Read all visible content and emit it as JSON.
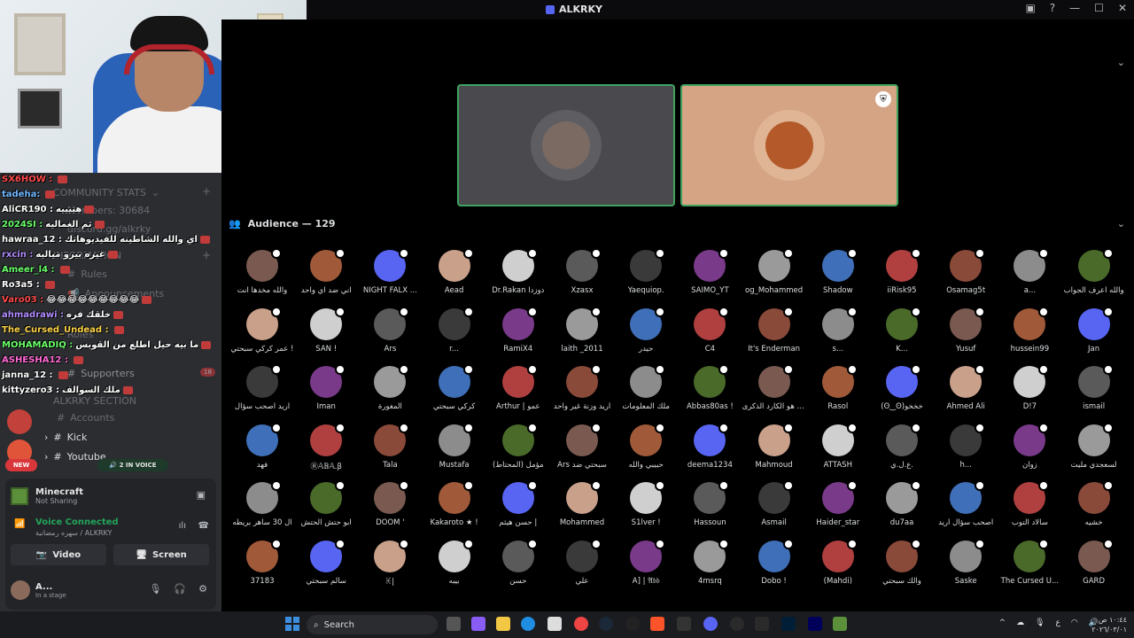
{
  "window": {
    "title": "ALKRKY"
  },
  "sidebar": {
    "stats_header": "COMMUNITY STATS",
    "members": "Members: 30684",
    "invite": "discord.gg/alkrky",
    "info_header": "INFORMATION",
    "rules": "Rules",
    "announcements": "Announcements",
    "roles": "Roles",
    "supporters": "Supporters",
    "supporters_badge": "18",
    "alkrky_section": "ALKRKY SECTION",
    "accounts": "Accounts",
    "kick": "Kick",
    "youtube": "Youtube",
    "new_badge": "NEW",
    "in_voice": "2 IN VOICE"
  },
  "chat": [
    {
      "user": "SX6HOW :",
      "color": "#ff4a4a",
      "msg": ""
    },
    {
      "user": "tadeha:",
      "color": "#6fb7ff",
      "msg": ""
    },
    {
      "user": "AliCR190 :",
      "color": "#ffffff",
      "msg": "هييييه"
    },
    {
      "user": "2024SI :",
      "color": "#6aff6a",
      "msg": "ثم الغماليه"
    },
    {
      "user": "hawraa_12 :",
      "color": "#ffffff",
      "msg": "اي والله الشاطينه للفيديوهاتك"
    },
    {
      "user": "rxcin :",
      "color": "#b28cff",
      "msg": "غيره بيرو مياليه"
    },
    {
      "user": "Ameer_l4 :",
      "color": "#6aff6a",
      "msg": ""
    },
    {
      "user": "Ro3a5 :",
      "color": "#ffffff",
      "msg": ""
    },
    {
      "user": "Varo03 :",
      "color": "#ff4a4a",
      "msg": "😂😂😂😂😂😂😂😂😂"
    },
    {
      "user": "ahmadrawi :",
      "color": "#b28cff",
      "msg": "خلقك فره"
    },
    {
      "user": "The_Cursed_Undead :",
      "color": "#ffd54a",
      "msg": ""
    },
    {
      "user": "MOHAMADIQ :",
      "color": "#6aff6a",
      "msg": "ما بيه حيل اطلع من القوبس"
    },
    {
      "user": "ASHESHA12 :",
      "color": "#ff6ad5",
      "msg": ""
    },
    {
      "user": "janna_12 :",
      "color": "#ffffff",
      "msg": ""
    },
    {
      "user": "kittyzero3 :",
      "color": "#ffffff",
      "msg": "ملك السوالف"
    }
  ],
  "activity": {
    "name": "Minecraft",
    "status": "Not Sharing"
  },
  "voice": {
    "status": "Voice Connected",
    "channel": "سهره رمضانية / ALKRKY"
  },
  "buttons": {
    "video": "Video",
    "screen": "Screen"
  },
  "user": {
    "name": "A...",
    "status": "In a stage"
  },
  "stage": {
    "speakers": 2
  },
  "audience": {
    "label": "Audience — 129"
  },
  "members": [
    "والله مخدها انت",
    "اني ضد اي واحد",
    "NIGHT FALX ...",
    "Aead",
    "Dr.Rakan دوزدا",
    "Xzasx",
    "Yaequiop.",
    "SAIMO_YT",
    "og_Mohammed",
    "Shadow",
    "iiRisk95",
    "Osamag5t",
    "a...",
    "والله اعرف الجواب",
    "عمر كركي سبحتي !",
    "SAN !",
    "Ars",
    "r...",
    "RamiX4",
    "laith _2011",
    "حيدر",
    "C4",
    "It's Enderman",
    "s...",
    "K...",
    "Yusuf",
    "hussein99",
    "Jan",
    "اريد اصحب سؤال",
    "Iman",
    "المغورة",
    "كركي سبحتي",
    "Arthur | عمو",
    "اريد وزنة غير واحد",
    "ملك المعلومات",
    "Abbas80as !",
    "اني هو الكارد الذكرى",
    "Rasol",
    "(ʘ‿ʘ)خخخو",
    "Ahmed Ali",
    "D!7",
    "ismail",
    "فهد",
    "Ⓡ𝔸𝔹𝔸.β",
    "Tala",
    "Mustafa",
    "مؤمل (المحتاط)",
    "Ars سبحتي ضد",
    "حبيبي والله",
    "deema1234",
    "Mahmoud",
    "ATTASH",
    "ع.ل.ي.",
    "h...",
    "زوان",
    "لسعجدي مليت",
    "ال 30 ساهر بريطه",
    "ابو حتش الحتش",
    "DOOM '",
    "Kakaroto ★ !",
    "حسن هيثم |",
    "Mohammed",
    "S1lver !",
    "Hassoun",
    "Asmail",
    "Haider_star",
    "du7aa",
    "اصحب سؤال اريد",
    "سالاد التوب",
    "خشيه",
    "37183",
    "سالم سبحتي",
    "ꀘ|",
    "بيبه",
    "حسن",
    "علي",
    "A] | 𝔄𝔟𝔟",
    "4msrq",
    "Dobo !",
    "(Mahdi)",
    "والك سبحتي",
    "Saske",
    "The Cursed U...",
    "GARD"
  ],
  "taskbar": {
    "search": "Search",
    "clock_time": "١٠:٤٤ ص",
    "clock_date": "٢٠٢٦/٠٣/٠١",
    "lang": "ع"
  }
}
